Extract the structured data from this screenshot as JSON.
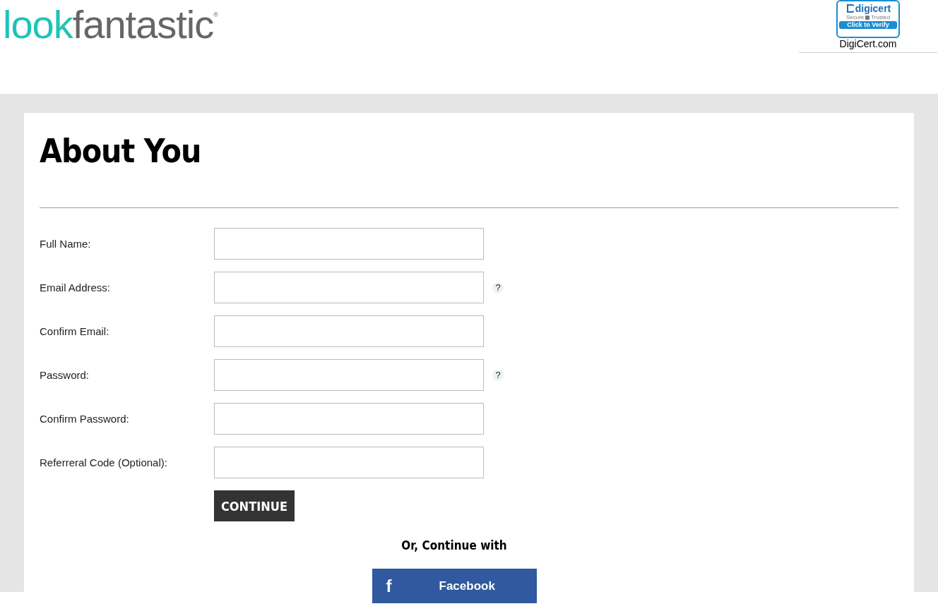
{
  "header": {
    "logo": {
      "part_1": "look",
      "part_2": "fantastic",
      "mark": "®"
    },
    "seal": {
      "brand": "digicert",
      "secure": "Secure",
      "trusted": "Trusted",
      "verify": "Click to Verify",
      "caption": "DigiCert.com"
    }
  },
  "form": {
    "title": "About You",
    "fields": [
      {
        "label": "Full Name:"
      },
      {
        "label": "Email Address:",
        "help": "?"
      },
      {
        "label": "Confirm Email:"
      },
      {
        "label": "Password:",
        "help": "?"
      },
      {
        "label": "Confirm Password:"
      },
      {
        "label": "Referreral Code (Optional):"
      }
    ],
    "submit": "CONTINUE",
    "alt_text": "Or, Continue with",
    "social": [
      {
        "kind": "facebook",
        "icon": "f",
        "label": "Facebook"
      }
    ]
  }
}
